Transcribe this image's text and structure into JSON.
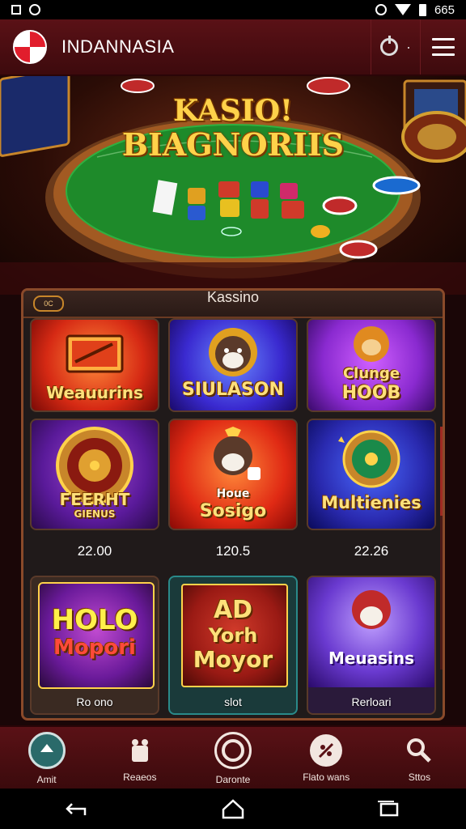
{
  "status_bar": {
    "time": "665"
  },
  "header": {
    "title": "INDANNASIA"
  },
  "hero": {
    "title_line1": "KASIO!",
    "title_line2": "BIAGNORIIS"
  },
  "panel": {
    "title": "Kassino",
    "badge": "0C",
    "games_row1": [
      {
        "name": "Weauurins"
      },
      {
        "name": "SIULASON"
      },
      {
        "name_line1": "Clunge",
        "name_line2": "HOOB"
      }
    ],
    "games_row2": [
      {
        "name_line1": "FEERHT",
        "name_line2": "GIENUS"
      },
      {
        "name_line1": "Houe",
        "name_line2": "Sosigo"
      },
      {
        "name": "Multienies"
      }
    ],
    "values": [
      "22.00",
      "120.5",
      "22.26"
    ],
    "games_row3": [
      {
        "name_line1": "HOLO",
        "name_line2": "Mopori",
        "caption": "Ro ono"
      },
      {
        "name_line1": "AD",
        "name_line2": "Yorh",
        "name_line3": "Moyor",
        "caption": "slot"
      },
      {
        "name": "Meuasins",
        "caption": "Rerloari"
      }
    ]
  },
  "bottom_nav": {
    "items": [
      {
        "label": "Amit"
      },
      {
        "label": "Reaeos"
      },
      {
        "label": "Daronte"
      },
      {
        "label": "Flato wans"
      },
      {
        "label": "Sttos"
      }
    ]
  }
}
